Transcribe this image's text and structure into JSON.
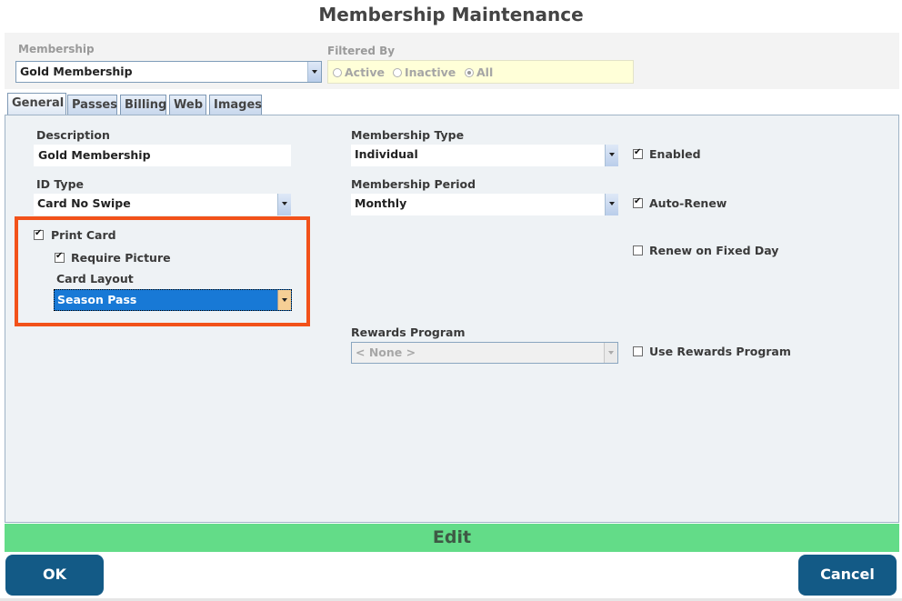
{
  "window": {
    "title": "Membership Maintenance"
  },
  "membership": {
    "label": "Membership",
    "selected": "Gold Membership"
  },
  "filter": {
    "label": "Filtered By",
    "options": [
      "Active",
      "Inactive",
      "All"
    ],
    "selected": "All"
  },
  "tabs": [
    {
      "label": "General",
      "active": true
    },
    {
      "label": "Passes"
    },
    {
      "label": "Billing"
    },
    {
      "label": "Web"
    },
    {
      "label": "Images"
    }
  ],
  "general": {
    "description": {
      "label": "Description",
      "value": "Gold Membership"
    },
    "id_type": {
      "label": "ID Type",
      "value": "Card No Swipe"
    },
    "print_card": {
      "label": "Print Card",
      "checked": true
    },
    "require_picture": {
      "label": "Require Picture",
      "checked": true
    },
    "card_layout": {
      "label": "Card Layout",
      "value": "Season Pass"
    },
    "membership_type": {
      "label": "Membership Type",
      "value": "Individual"
    },
    "membership_period": {
      "label": "Membership Period",
      "value": "Monthly"
    },
    "enabled": {
      "label": "Enabled",
      "checked": true
    },
    "auto_renew": {
      "label": "Auto-Renew",
      "checked": true
    },
    "renew_fixed_day": {
      "label": "Renew on Fixed Day",
      "checked": false
    },
    "rewards_program": {
      "label": "Rewards Program",
      "value": "< None >"
    },
    "use_rewards": {
      "label": "Use Rewards Program",
      "checked": false
    }
  },
  "status_bar": {
    "text": "Edit"
  },
  "buttons": {
    "ok": "OK",
    "cancel": "Cancel"
  },
  "colors": {
    "highlight": "#f2521a",
    "edit_bar": "#63dc88",
    "button": "#135a86",
    "selection": "#1879d6"
  }
}
